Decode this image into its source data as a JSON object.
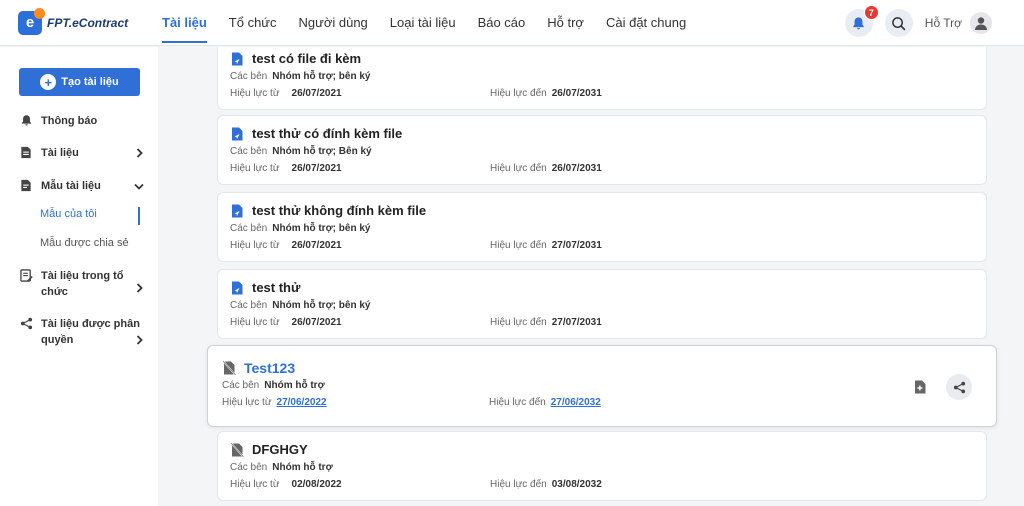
{
  "app": {
    "logo_letter": "e",
    "logo_text": "FPT.eContract"
  },
  "nav": {
    "tabs": [
      {
        "label": "Tài liệu",
        "active": true
      },
      {
        "label": "Tổ chức"
      },
      {
        "label": "Người dùng"
      },
      {
        "label": "Loại tài liệu"
      },
      {
        "label": "Báo cáo"
      },
      {
        "label": "Hỗ trợ"
      },
      {
        "label": "Cài đặt chung"
      }
    ],
    "notification_count": "7",
    "user_name": "Hỗ Trợ"
  },
  "sidebar": {
    "create_label": "Tạo tài liệu",
    "items": [
      {
        "label": "Thông báo",
        "icon": "bell-icon"
      },
      {
        "label": "Tài liệu",
        "icon": "document-icon"
      },
      {
        "label": "Mẫu tài liệu",
        "icon": "template-icon"
      },
      {
        "label": "Tài liệu trong tổ chức",
        "icon": "org-document-icon"
      },
      {
        "label": "Tài liệu được phân quyền",
        "icon": "share-icon"
      }
    ],
    "sub_items": [
      {
        "label": "Mẫu của tôi",
        "active": true
      },
      {
        "label": "Mẫu được chia sẻ"
      }
    ]
  },
  "labels": {
    "parties": "Các bên",
    "valid_from": "Hiệu lực từ",
    "valid_to": "Hiệu lực đến"
  },
  "cards": [
    {
      "title": "test có file đi kèm",
      "parties": "Nhóm hỗ trợ; bên ký",
      "from": "26/07/2021",
      "to": "26/07/2031",
      "icon": "doc-send-icon"
    },
    {
      "title": "test thử có đính kèm file",
      "parties": "Nhóm hỗ trợ; Bên ký",
      "from": "26/07/2021",
      "to": "26/07/2031",
      "icon": "doc-send-icon"
    },
    {
      "title": "test thử không đính kèm file",
      "parties": "Nhóm hỗ trợ; bên ký",
      "from": "26/07/2021",
      "to": "27/07/2031",
      "icon": "doc-send-icon"
    },
    {
      "title": "test thử",
      "parties": "Nhóm hỗ trợ; bên ký",
      "from": "26/07/2021",
      "to": "27/07/2031",
      "icon": "doc-send-icon"
    },
    {
      "title": "Test123",
      "parties": "Nhóm hỗ trợ",
      "from": "27/06/2022",
      "to": "27/06/2032",
      "icon": "doc-disabled-icon",
      "selected": true
    },
    {
      "title": "DFGHGY",
      "parties": "Nhóm hỗ trợ",
      "from": "02/08/2022",
      "to": "03/08/2032",
      "icon": "doc-disabled-icon"
    }
  ],
  "colors": {
    "accent": "#2f6fd6",
    "badge": "#e53935",
    "background": "#f4f5f7"
  }
}
